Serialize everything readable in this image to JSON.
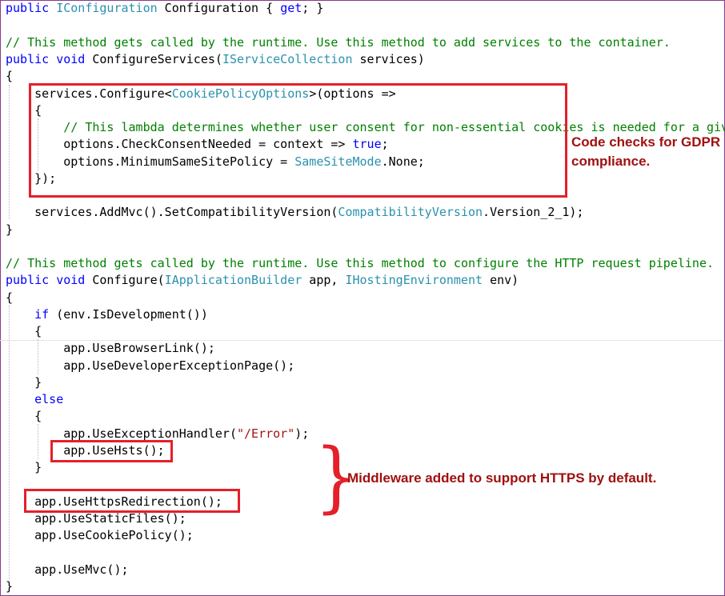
{
  "code": {
    "line_01": [
      {
        "t": "public",
        "c": "kw"
      },
      {
        "t": " "
      },
      {
        "t": "IConfiguration",
        "c": "ty"
      },
      {
        "t": " Configuration { "
      },
      {
        "t": "get",
        "c": "kw"
      },
      {
        "t": "; }"
      }
    ],
    "line_02": [
      {
        "t": "// This method gets called by the runtime. Use this method to add services to the container.",
        "c": "cm"
      }
    ],
    "line_03": [
      {
        "t": "public",
        "c": "kw"
      },
      {
        "t": " "
      },
      {
        "t": "void",
        "c": "kw"
      },
      {
        "t": " ConfigureServices("
      },
      {
        "t": "IServiceCollection",
        "c": "ty"
      },
      {
        "t": " services)"
      }
    ],
    "line_04": [
      {
        "t": "{"
      }
    ],
    "line_05": [
      {
        "t": "    services.Configure<"
      },
      {
        "t": "CookiePolicyOptions",
        "c": "ty"
      },
      {
        "t": ">(options =>"
      }
    ],
    "line_06": [
      {
        "t": "    {"
      }
    ],
    "line_07": [
      {
        "t": "        // This lambda determines whether user consent for non-essential cookies is needed for a giv",
        "c": "cm"
      }
    ],
    "line_08": [
      {
        "t": "        options.CheckConsentNeeded = context => "
      },
      {
        "t": "true",
        "c": "kw"
      },
      {
        "t": ";"
      }
    ],
    "line_09": [
      {
        "t": "        options.MinimumSameSitePolicy = "
      },
      {
        "t": "SameSiteMode",
        "c": "ty"
      },
      {
        "t": ".None;"
      }
    ],
    "line_10": [
      {
        "t": "    });"
      }
    ],
    "line_11": [
      {
        "t": "    services.AddMvc().SetCompatibilityVersion("
      },
      {
        "t": "CompatibilityVersion",
        "c": "ty"
      },
      {
        "t": ".Version_2_1);"
      }
    ],
    "line_12": [
      {
        "t": "}"
      }
    ],
    "line_13": [
      {
        "t": "// This method gets called by the runtime. Use this method to configure the HTTP request pipeline.",
        "c": "cm"
      }
    ],
    "line_14": [
      {
        "t": "public",
        "c": "kw"
      },
      {
        "t": " "
      },
      {
        "t": "void",
        "c": "kw"
      },
      {
        "t": " Configure("
      },
      {
        "t": "IApplicationBuilder",
        "c": "ty"
      },
      {
        "t": " app, "
      },
      {
        "t": "IHostingEnvironment",
        "c": "ty"
      },
      {
        "t": " env)"
      }
    ],
    "line_15": [
      {
        "t": "{"
      }
    ],
    "line_16": [
      {
        "t": "    "
      },
      {
        "t": "if",
        "c": "kw"
      },
      {
        "t": " (env.IsDevelopment())"
      }
    ],
    "line_17": [
      {
        "t": "    {"
      }
    ],
    "line_18": [
      {
        "t": "        app.UseBrowserLink();"
      }
    ],
    "line_19": [
      {
        "t": "        app.UseDeveloperExceptionPage();"
      }
    ],
    "line_20": [
      {
        "t": "    }"
      }
    ],
    "line_21": [
      {
        "t": "    "
      },
      {
        "t": "else",
        "c": "kw"
      }
    ],
    "line_22": [
      {
        "t": "    {"
      }
    ],
    "line_23": [
      {
        "t": "        app.UseExceptionHandler("
      },
      {
        "t": "\"/Error\"",
        "c": "st"
      },
      {
        "t": ");"
      }
    ],
    "line_24": [
      {
        "t": "        app.UseHsts();"
      }
    ],
    "line_25": [
      {
        "t": "    }"
      }
    ],
    "line_26": [
      {
        "t": "    app.UseHttpsRedirection();"
      }
    ],
    "line_27": [
      {
        "t": "    app.UseStaticFiles();"
      }
    ],
    "line_28": [
      {
        "t": "    app.UseCookiePolicy();"
      }
    ],
    "line_29": [
      {
        "t": "    app.UseMvc();"
      }
    ],
    "line_30": [
      {
        "t": "}"
      }
    ]
  },
  "annotations": {
    "gdpr_line1": "Code checks for GDPR",
    "gdpr_line2": "compliance.",
    "https_note": "Middleware added to support HTTPS by default.",
    "brace_glyph": "}"
  },
  "colors": {
    "keyword": "#0000ff",
    "type": "#2b91af",
    "comment": "#008000",
    "string": "#a31515",
    "highlight_box": "#e4202a",
    "annotation_text": "#a01010"
  }
}
